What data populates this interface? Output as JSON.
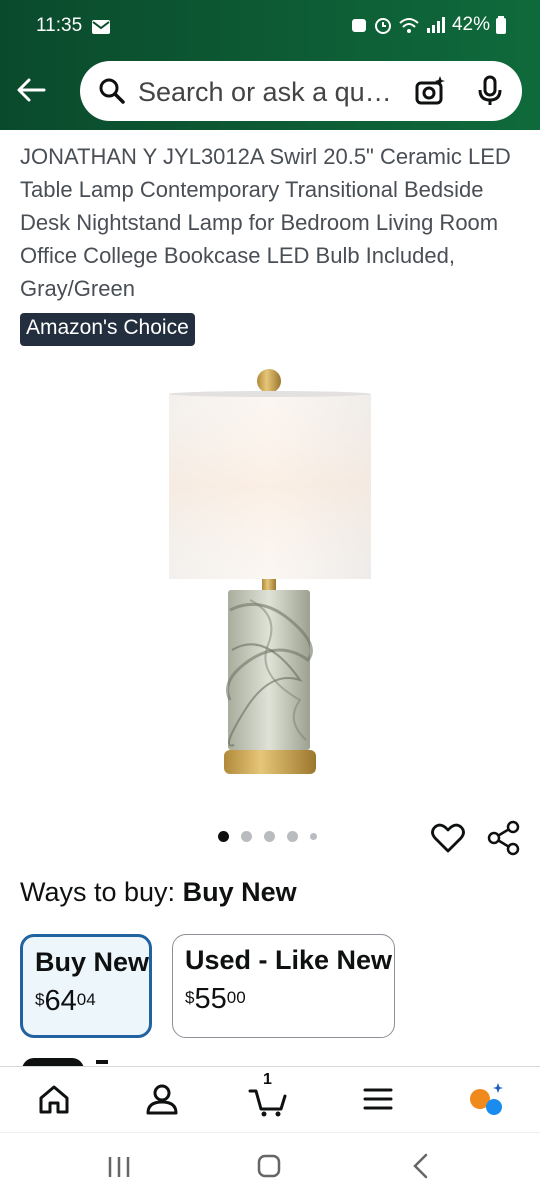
{
  "status_bar": {
    "time": "11:35",
    "battery": "42%"
  },
  "search": {
    "placeholder": "Search or ask a question"
  },
  "product": {
    "title": "JONATHAN Y JYL3012A Swirl 20.5\" Ceramic LED Table Lamp Contemporary Transitional Bedside Desk Nightstand Lamp for Bedroom Living Room Office College Bookcase LED Bulb Included, Gray/Green",
    "badge": "Amazon's Choice",
    "image_count": 5,
    "active_image_index": 0
  },
  "ways_to_buy": {
    "label": "Ways to buy:",
    "selected": "Buy New",
    "options": [
      {
        "label": "Buy New",
        "currency": "$",
        "whole": "64",
        "fraction": "04"
      },
      {
        "label": "Used - Like New",
        "currency": "$",
        "whole": "55",
        "fraction": "00"
      }
    ]
  },
  "bottom_nav": {
    "cart_count": "1"
  },
  "colors": {
    "header_green": "#0d5c35",
    "selected_border": "#2162a1",
    "badge_bg": "#232f3e"
  },
  "icons": [
    "back-arrow-icon",
    "search-icon",
    "camera-sparkle-icon",
    "microphone-icon",
    "heart-icon",
    "share-icon",
    "home-icon",
    "account-icon",
    "cart-icon",
    "menu-icon",
    "rufus-icon"
  ]
}
